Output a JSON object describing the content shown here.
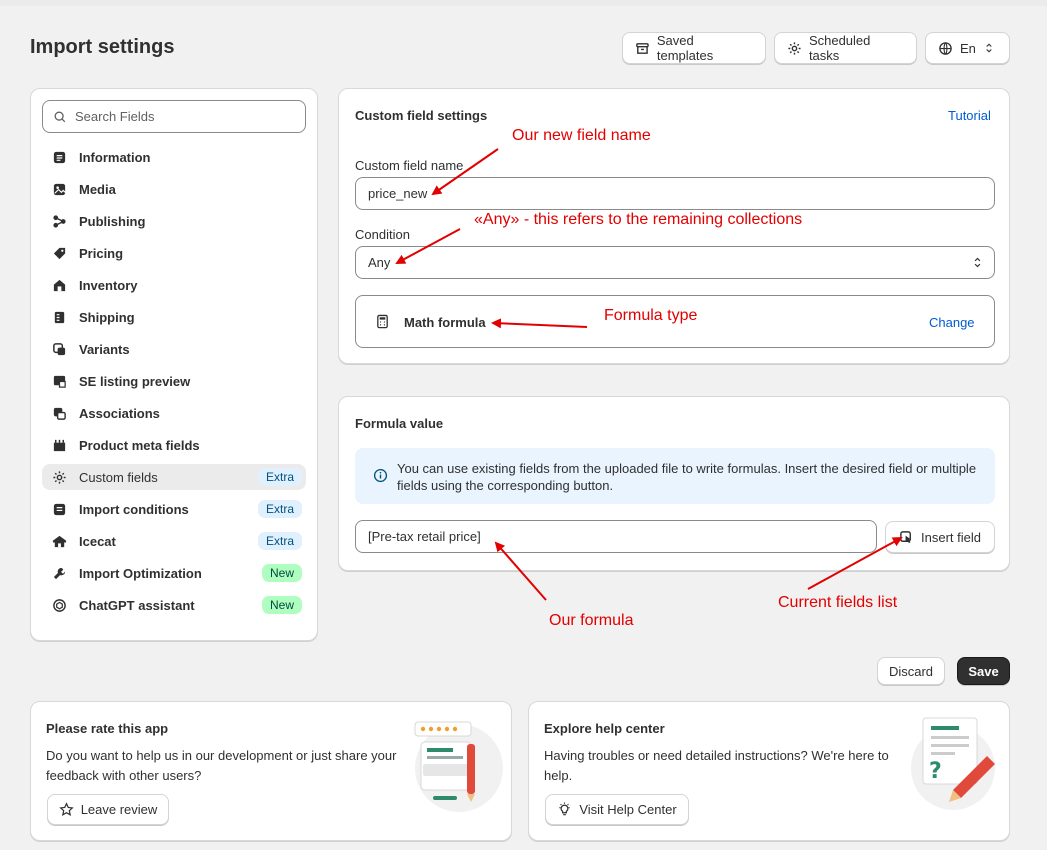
{
  "page": {
    "title": "Import settings"
  },
  "header_buttons": {
    "saved_templates": "Saved templates",
    "scheduled_tasks": "Scheduled tasks",
    "language": "En"
  },
  "sidebar": {
    "search_placeholder": "Search Fields",
    "items": [
      {
        "label": "Information",
        "icon": "information-icon"
      },
      {
        "label": "Media",
        "icon": "media-icon"
      },
      {
        "label": "Publishing",
        "icon": "publishing-icon"
      },
      {
        "label": "Pricing",
        "icon": "pricing-icon"
      },
      {
        "label": "Inventory",
        "icon": "inventory-icon"
      },
      {
        "label": "Shipping",
        "icon": "shipping-icon"
      },
      {
        "label": "Variants",
        "icon": "variants-icon"
      },
      {
        "label": "SE listing preview",
        "icon": "se-listing-icon"
      },
      {
        "label": "Associations",
        "icon": "associations-icon"
      },
      {
        "label": "Product meta fields",
        "icon": "meta-fields-icon"
      },
      {
        "label": "Custom fields",
        "icon": "gear-icon",
        "badge": "Extra",
        "active": true
      },
      {
        "label": "Import conditions",
        "icon": "conditions-icon",
        "badge": "Extra"
      },
      {
        "label": "Icecat",
        "icon": "icecat-icon",
        "badge": "Extra"
      },
      {
        "label": "Import Optimization",
        "icon": "wrench-icon",
        "badge": "New"
      },
      {
        "label": "ChatGPT assistant",
        "icon": "chatgpt-icon",
        "badge": "New"
      }
    ]
  },
  "custom_field_settings": {
    "title": "Custom field settings",
    "tutorial_link": "Tutorial",
    "name_label": "Custom field name",
    "name_value": "price_new",
    "condition_label": "Condition",
    "condition_value": "Any",
    "formula_type": "Math formula",
    "change_link": "Change"
  },
  "formula_value": {
    "title": "Formula value",
    "info_text": "You can use existing fields from the uploaded file to write formulas. Insert the desired field or multiple fields using the corresponding button.",
    "formula_input": "[Pre-tax retail price]",
    "insert_field_button": "Insert field"
  },
  "actions": {
    "discard": "Discard",
    "save": "Save"
  },
  "rate_card": {
    "title": "Please rate this app",
    "text": "Do you want to help us in our development or just share your feedback with other users?",
    "button": "Leave review"
  },
  "help_card": {
    "title": "Explore help center",
    "text": "Having troubles or need detailed instructions? We're here to help.",
    "button": "Visit Help Center"
  },
  "annotations": {
    "new_field_name": "Our new field name",
    "any_note": "«Any» - this refers to the remaining collections",
    "formula_type": "Formula type",
    "our_formula": "Our formula",
    "current_fields": "Current fields list"
  },
  "colors": {
    "annotation": "#e20000",
    "link": "#005bd3",
    "primary_button": "#303030"
  }
}
